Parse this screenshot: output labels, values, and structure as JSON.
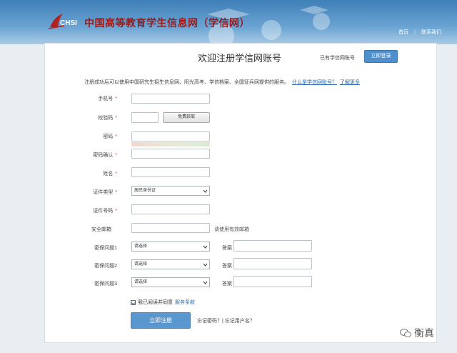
{
  "header": {
    "logo_text": "CHSI",
    "site_title": "中国高等教育学生信息网（学信网）",
    "links": [
      "首页",
      "联系我们"
    ],
    "link_separator": "|"
  },
  "card": {
    "title": "欢迎注册学信网账号",
    "has_account_text": "已有学信网账号",
    "login_button": "立即登录",
    "notice_text": "注册成功后可以使用中国研究生招生信息网、阳光高考、学信档案、全国征兵网提供的服务。",
    "notice_link_what": "什么是学信网账号？",
    "notice_link_more": "了解更多"
  },
  "form": {
    "phone": {
      "label": "手机号",
      "required": "*",
      "value": ""
    },
    "captcha": {
      "label": "校验码",
      "required": "*",
      "value": "",
      "button": "免费获取"
    },
    "password": {
      "label": "密码",
      "required": "*",
      "value": ""
    },
    "password_confirm": {
      "label": "密码确认",
      "required": "*",
      "value": ""
    },
    "name": {
      "label": "姓名",
      "required": "*",
      "value": ""
    },
    "id_type": {
      "label": "证件类型",
      "required": "*",
      "selected": "居民身份证"
    },
    "id_number": {
      "label": "证件号码",
      "required": "*",
      "value": ""
    },
    "email": {
      "label": "安全邮箱",
      "value": "",
      "hint": "请使用有效邮箱"
    },
    "questions": [
      {
        "label": "密保问题1",
        "selected": "请选择",
        "answer_label": "答案",
        "answer": ""
      },
      {
        "label": "密保问题2",
        "selected": "请选择",
        "answer_label": "答案",
        "answer": ""
      },
      {
        "label": "密保问题3",
        "selected": "请选择",
        "answer_label": "答案",
        "answer": ""
      }
    ],
    "agree_text": "我已阅读并同意",
    "agree_link": "服务条款",
    "agree_checked": true,
    "submit": "立即注册",
    "forgot_text": "忘记密码？| 忘记用户名？"
  },
  "watermark": {
    "text": "衡真"
  },
  "colors": {
    "header": "#4a88c0",
    "title_red": "#9c1b1b",
    "button_blue": "#5b97cf",
    "link_blue": "#2a6db3",
    "required_red": "#d23333"
  }
}
